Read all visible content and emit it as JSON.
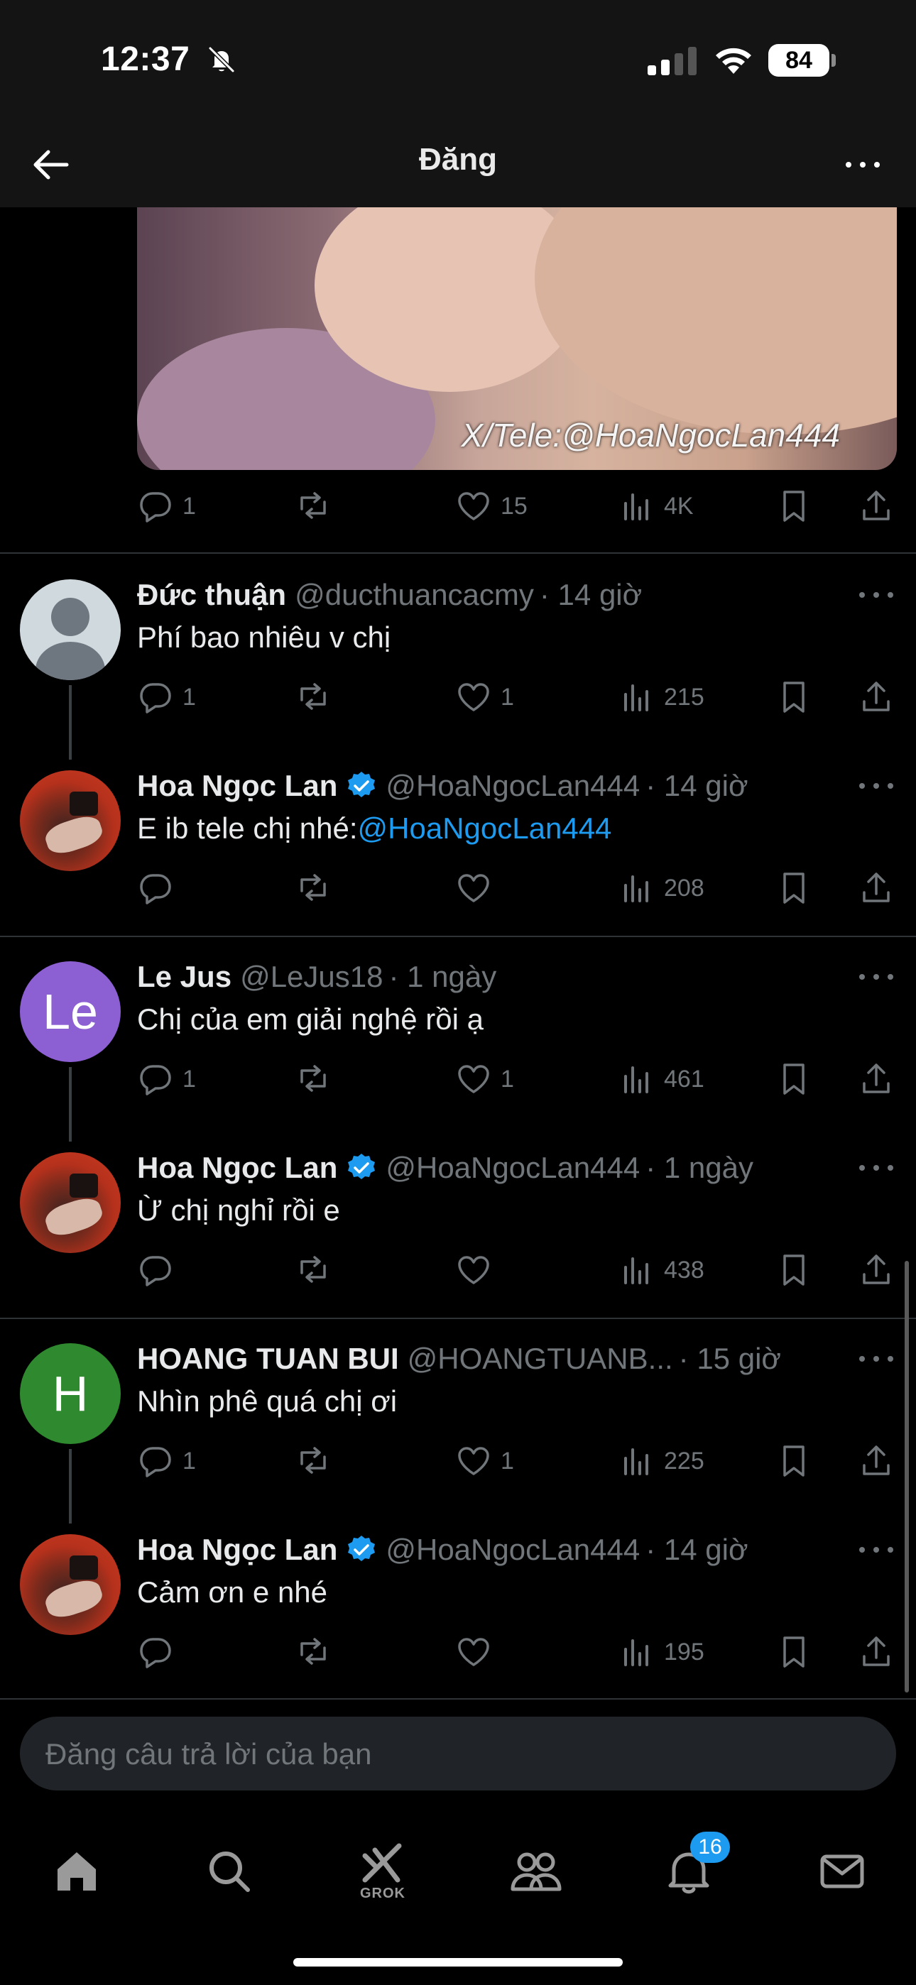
{
  "status_bar": {
    "time": "12:37",
    "battery": "84"
  },
  "header": {
    "title": "Đăng"
  },
  "media": {
    "watermark": "X/Tele:@HoaNgocLan444"
  },
  "main_post_actions": {
    "replies": "1",
    "reposts": "",
    "likes": "15",
    "views": "4K"
  },
  "replies": [
    {
      "name": "Đức thuận",
      "handle": "@ducthuancacmy",
      "time": "· 14 giờ",
      "verified": false,
      "text": "Phí bao nhiêu v chị",
      "mention": "",
      "stats": {
        "replies": "1",
        "likes": "1",
        "views": "215"
      }
    },
    {
      "name": "Hoa Ngọc Lan",
      "handle": "@HoaNgocLan444",
      "time": "· 14 giờ",
      "verified": true,
      "text": "E ib tele chị nhé:",
      "mention": "@HoaNgocLan444",
      "stats": {
        "replies": "",
        "likes": "",
        "views": "208"
      }
    },
    {
      "name": "Le Jus",
      "handle": "@LeJus18",
      "time": "· 1 ngày",
      "verified": false,
      "avatar_letter": "Le",
      "text": "Chị của em giải nghệ rồi ạ",
      "mention": "",
      "stats": {
        "replies": "1",
        "likes": "1",
        "views": "461"
      }
    },
    {
      "name": "Hoa Ngọc Lan",
      "handle": "@HoaNgocLan444",
      "time": "· 1 ngày",
      "verified": true,
      "text": "Ừ chị nghỉ rồi e",
      "mention": "",
      "stats": {
        "replies": "",
        "likes": "",
        "views": "438"
      }
    },
    {
      "name": "HOANG TUAN BUI",
      "handle": "@HOANGTUANB...",
      "time": "· 15 giờ",
      "verified": false,
      "avatar_letter": "H",
      "text": "Nhìn phê quá chị ơi",
      "mention": "",
      "stats": {
        "replies": "1",
        "likes": "1",
        "views": "225"
      }
    },
    {
      "name": "Hoa Ngọc Lan",
      "handle": "@HoaNgocLan444",
      "time": "· 14 giờ",
      "verified": true,
      "text": "Cảm ơn e nhé",
      "mention": "",
      "stats": {
        "replies": "",
        "likes": "",
        "views": "195"
      }
    }
  ],
  "reply_box": {
    "placeholder": "Đăng câu trả lời của bạn"
  },
  "tab_bar": {
    "grok_label": "GROK",
    "notifications_badge": "16"
  },
  "colors": {
    "background": "#000000",
    "accent": "#1d9bf0",
    "muted_text": "#71767b",
    "divider": "#2f3336"
  },
  "icons": [
    "back-arrow-icon",
    "more-icon",
    "reply-icon",
    "repost-icon",
    "like-icon",
    "views-icon",
    "bookmark-icon",
    "share-icon",
    "verified-icon",
    "home-icon",
    "search-icon",
    "grok-icon",
    "communities-icon",
    "notifications-icon",
    "messages-icon"
  ]
}
